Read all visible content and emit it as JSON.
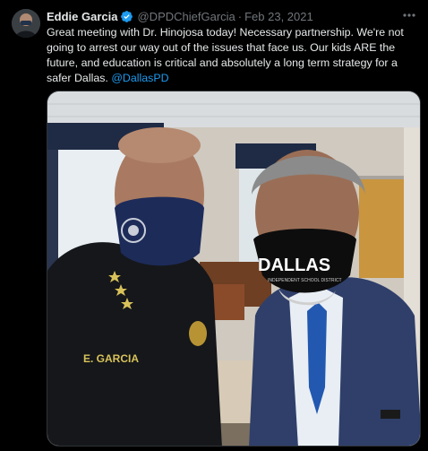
{
  "tweet": {
    "display_name": "Eddie Garcia",
    "handle": "@DPDChiefGarcia",
    "separator": "·",
    "date": "Feb 23, 2021",
    "more_icon": "more-horizontal-icon",
    "verified_icon": "verified-badge-icon",
    "text_main": "Great meeting with Dr. Hinojosa today! Necessary partnership. We're not going to arrest our way out of the issues that face us. Our kids ARE the future, and education is critical and absolutely a long term strategy for a safer Dallas.",
    "mention": "@DallasPD",
    "photo": {
      "uniform_name_tag": "E. GARCIA",
      "mask_text": "DALLAS",
      "mask_subtext": "INDEPENDENT SCHOOL DISTRICT"
    }
  },
  "colors": {
    "background": "#000000",
    "text": "#e7e9ea",
    "muted": "#71767b",
    "link": "#1d9bf0",
    "verified": "#1d9bf0"
  }
}
